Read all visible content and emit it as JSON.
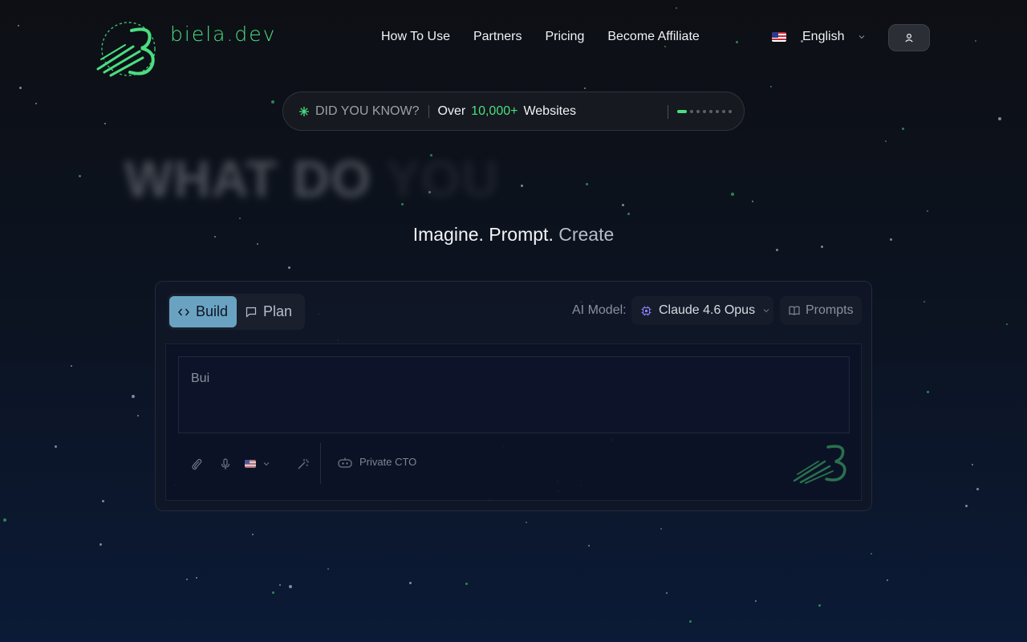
{
  "brand": {
    "name": "biela.dev",
    "accent": "#4ade80"
  },
  "nav": {
    "items": [
      {
        "label": "How To Use"
      },
      {
        "label": "Partners"
      },
      {
        "label": "Pricing"
      },
      {
        "label": "Become Affiliate"
      }
    ]
  },
  "language": {
    "flag": "us-flag-icon",
    "label": "English"
  },
  "user_button": {
    "icon": "user-icon"
  },
  "did_you_know": {
    "label": "DID YOU KNOW?",
    "prefix": "Over",
    "number": "10,000+",
    "suffix": "Websites",
    "slides_total": 8,
    "active_slide": 1
  },
  "hero": {
    "headline_visible": "WHAT DO",
    "headline_faint": "YOU",
    "tagline_main": "Imagine. Prompt.",
    "tagline_muted": "Create"
  },
  "composer": {
    "tabs": [
      {
        "label": "Build",
        "icon": "code-icon",
        "active": true
      },
      {
        "label": "Plan",
        "icon": "chat-bubble-icon",
        "active": false
      }
    ],
    "model_label": "AI Model:",
    "model_value": "Claude 4.6 Opus",
    "model_icon": "chip-icon",
    "prompts_label": "Prompts",
    "prompts_icon": "book-icon",
    "input_value": "Bui",
    "tools": [
      "paperclip-icon",
      "microphone-icon",
      "us-flag-icon",
      "magic-wand-icon"
    ],
    "cto_label": "Private CTO",
    "cto_icon": "robot-icon"
  },
  "colors": {
    "background_top": "#0d0f14",
    "background_bottom": "#0b1a36",
    "tab_active": "#6aa3c2",
    "text_muted": "#8a909b"
  }
}
